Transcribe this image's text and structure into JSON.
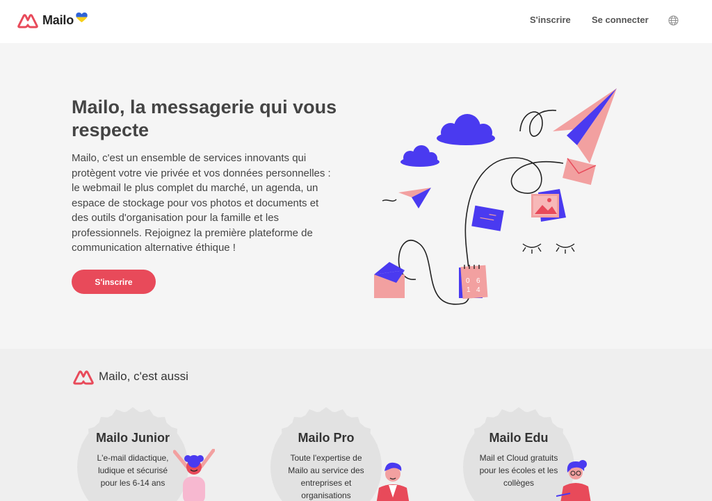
{
  "header": {
    "logo_text": "Mailo",
    "nav": {
      "signup": "S'inscrire",
      "login": "Se connecter"
    },
    "icons": [
      "mailo-logo-icon",
      "ukraine-heart-icon",
      "globe-icon"
    ]
  },
  "hero": {
    "title": "Mailo, la messagerie qui vous respecte",
    "description": "Mailo, c'est un ensemble de services innovants qui protègent votre vie privée et vos données personnelles : le webmail le plus complet du marché, un agenda, un espace de stockage pour vos photos et documents et des outils d'organisation pour la famille et les professionnels. Rejoignez la première plateforme de communication alternative éthique !",
    "cta": "S'inscrire",
    "calendar": {
      "digits": [
        "0",
        "6",
        "1",
        "4"
      ]
    }
  },
  "section": {
    "title": "Mailo, c'est aussi",
    "cards": [
      {
        "title": "Mailo Junior",
        "description": "L'e-mail didactique, ludique et sécurisé pour les 6-14 ans"
      },
      {
        "title": "Mailo Pro",
        "description": "Toute l'expertise de Mailo au service des entreprises et organisations"
      },
      {
        "title": "Mailo Edu",
        "description": "Mail et Cloud gratuits pour les écoles et les collèges"
      }
    ]
  },
  "colors": {
    "brand_red": "#e84a5a",
    "purple": "#4a3af0",
    "pink": "#f2a0a0",
    "text": "#444444",
    "badge": "#e2e2e2"
  }
}
